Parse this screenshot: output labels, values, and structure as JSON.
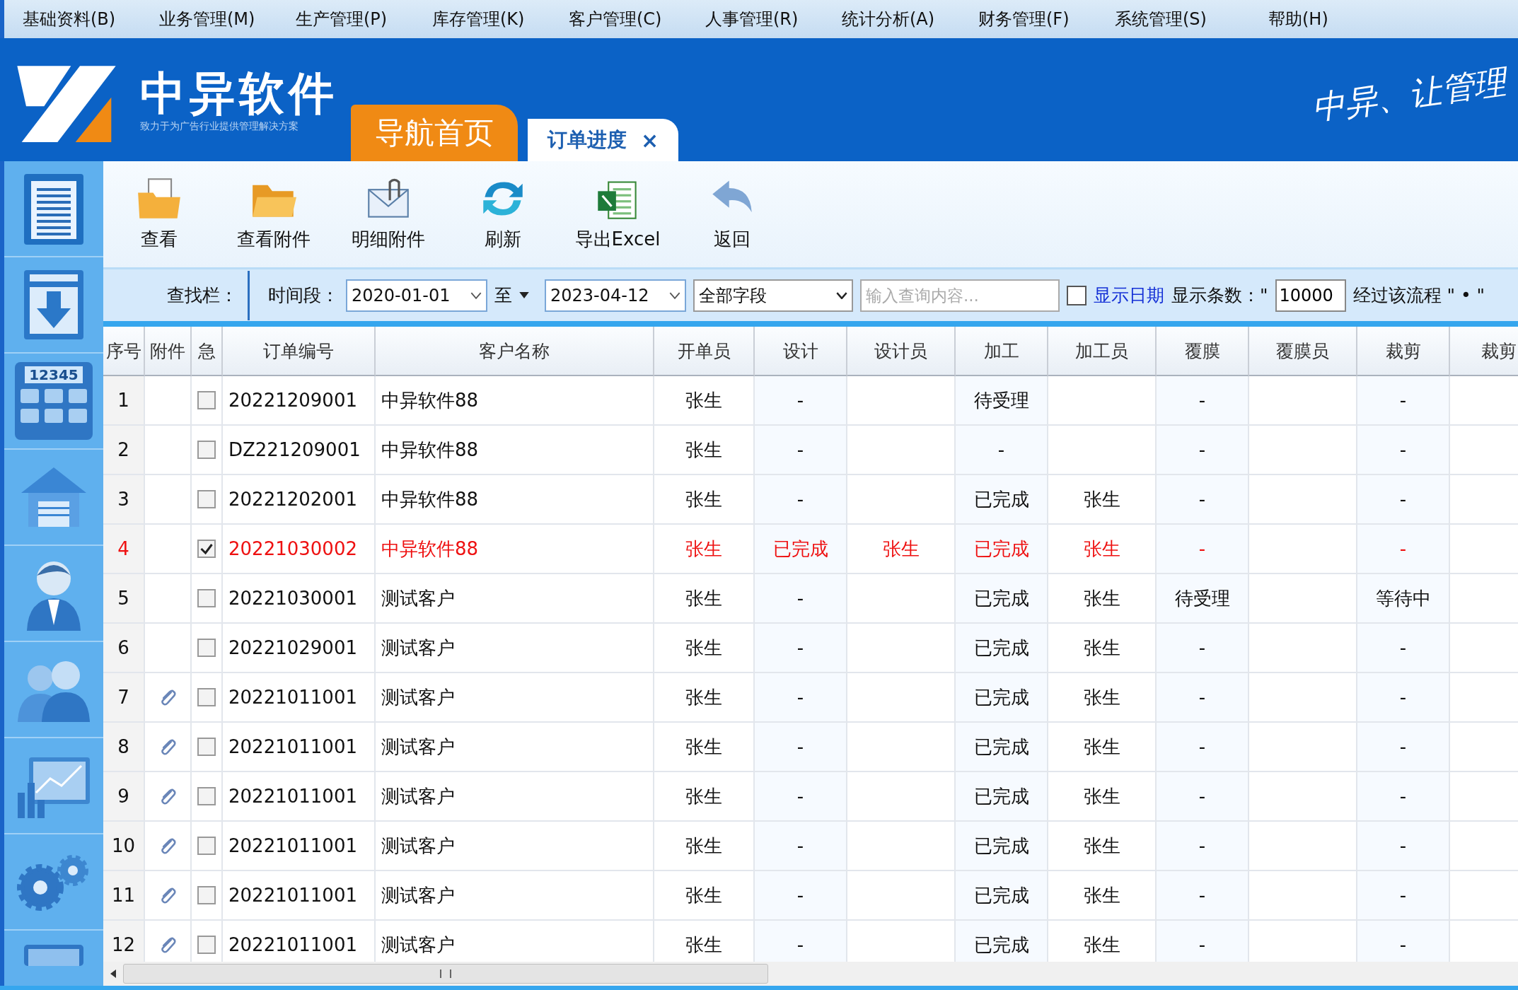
{
  "menu_bar": [
    "基础资料(B)",
    "业务管理(M)",
    "生产管理(P)",
    "库存管理(K)",
    "客户管理(C)",
    "人事管理(R)",
    "统计分析(A)",
    "财务管理(F)",
    "系统管理(S)",
    "帮助(H)"
  ],
  "header": {
    "brand": "中异软件",
    "tagline": "致力于为广告行业提供管理解决方案",
    "slogan": "中异、让管理",
    "tabs": [
      {
        "label": "导航首页",
        "selected": false
      },
      {
        "label": "订单进度",
        "selected": true,
        "close": "×"
      }
    ]
  },
  "sidebar": {
    "items": [
      {
        "kind": "document"
      },
      {
        "kind": "download"
      },
      {
        "kind": "calculator",
        "text": "12345"
      },
      {
        "kind": "house"
      },
      {
        "kind": "person"
      },
      {
        "kind": "people"
      },
      {
        "kind": "chart"
      },
      {
        "kind": "gears"
      },
      {
        "kind": "monitor"
      }
    ]
  },
  "toolbar": [
    {
      "label": "查看",
      "kind": "view"
    },
    {
      "label": "查看附件",
      "kind": "folder"
    },
    {
      "label": "明细附件",
      "kind": "mail"
    },
    {
      "label": "刷新",
      "kind": "refresh"
    },
    {
      "label": "导出Excel",
      "kind": "excel"
    },
    {
      "label": "返回",
      "kind": "back"
    }
  ],
  "search_bar": {
    "label": "查找栏：",
    "period_label": "时间段：",
    "date_from": "2020-01-01",
    "to_label": "至",
    "date_to": "2023-04-12",
    "field_select": "全部字段",
    "query_placeholder": "输入查询内容...",
    "show_date": {
      "label": "显示日期",
      "checked": false
    },
    "count_label": "显示条数：\"",
    "count": "10000",
    "flow_label": "经过该流程 \" • \""
  },
  "table": {
    "columns": [
      "序号",
      "附件",
      "急",
      "订单编号",
      "客户名称",
      "开单员",
      "设计",
      "设计员",
      "加工",
      "加工员",
      "覆膜",
      "覆膜员",
      "裁剪",
      "裁剪"
    ],
    "rows": [
      {
        "no": "1",
        "attachment": false,
        "urgent": false,
        "order_no": "20221209001",
        "customer": "中异软件88",
        "issuer": "张生",
        "design": "-",
        "processing": "待受理",
        "lamination": "-",
        "cutting": "-"
      },
      {
        "no": "2",
        "attachment": false,
        "urgent": false,
        "order_no": "DZ221209001",
        "customer": "中异软件88",
        "issuer": "张生",
        "design": "-",
        "processing": "-",
        "lamination": "-",
        "cutting": "-"
      },
      {
        "no": "3",
        "attachment": false,
        "urgent": false,
        "order_no": "20221202001",
        "customer": "中异软件88",
        "issuer": "张生",
        "design": "-",
        "processing": "已完成",
        "processor": "张生",
        "lamination": "-",
        "cutting": "-"
      },
      {
        "no": "4",
        "attachment": false,
        "urgent": true,
        "order_no": "20221030002",
        "customer": "中异软件88",
        "issuer": "张生",
        "design": "已完成",
        "designer": "张生",
        "processing": "已完成",
        "processor": "张生",
        "lamination": "-",
        "cutting": "-"
      },
      {
        "no": "5",
        "attachment": false,
        "urgent": false,
        "order_no": "20221030001",
        "customer": "测试客户",
        "issuer": "张生",
        "design": "-",
        "processing": "已完成",
        "processor": "张生",
        "lamination": "待受理",
        "cutting": "等待中"
      },
      {
        "no": "6",
        "attachment": false,
        "urgent": false,
        "order_no": "20221029001",
        "customer": "测试客户",
        "issuer": "张生",
        "design": "-",
        "processing": "已完成",
        "processor": "张生",
        "lamination": "-",
        "cutting": "-"
      },
      {
        "no": "7",
        "attachment": true,
        "urgent": false,
        "order_no": "20221011001",
        "customer": "测试客户",
        "issuer": "张生",
        "design": "-",
        "processing": "已完成",
        "processor": "张生",
        "lamination": "-",
        "cutting": "-"
      },
      {
        "no": "8",
        "attachment": true,
        "urgent": false,
        "order_no": "20221011001",
        "customer": "测试客户",
        "issuer": "张生",
        "design": "-",
        "processing": "已完成",
        "processor": "张生",
        "lamination": "-",
        "cutting": "-"
      },
      {
        "no": "9",
        "attachment": true,
        "urgent": false,
        "order_no": "20221011001",
        "customer": "测试客户",
        "issuer": "张生",
        "design": "-",
        "processing": "已完成",
        "processor": "张生",
        "lamination": "-",
        "cutting": "-"
      },
      {
        "no": "10",
        "attachment": true,
        "urgent": false,
        "order_no": "20221011001",
        "customer": "测试客户",
        "issuer": "张生",
        "design": "-",
        "processing": "已完成",
        "processor": "张生",
        "lamination": "-",
        "cutting": "-"
      },
      {
        "no": "11",
        "attachment": true,
        "urgent": false,
        "order_no": "20221011001",
        "customer": "测试客户",
        "issuer": "张生",
        "design": "-",
        "processing": "已完成",
        "processor": "张生",
        "lamination": "-",
        "cutting": "-"
      },
      {
        "no": "12",
        "attachment": true,
        "urgent": false,
        "order_no": "20221011001",
        "customer": "测试客户",
        "issuer": "张生",
        "design": "-",
        "processing": "已完成",
        "processor": "张生",
        "lamination": "-",
        "cutting": "-"
      }
    ]
  }
}
